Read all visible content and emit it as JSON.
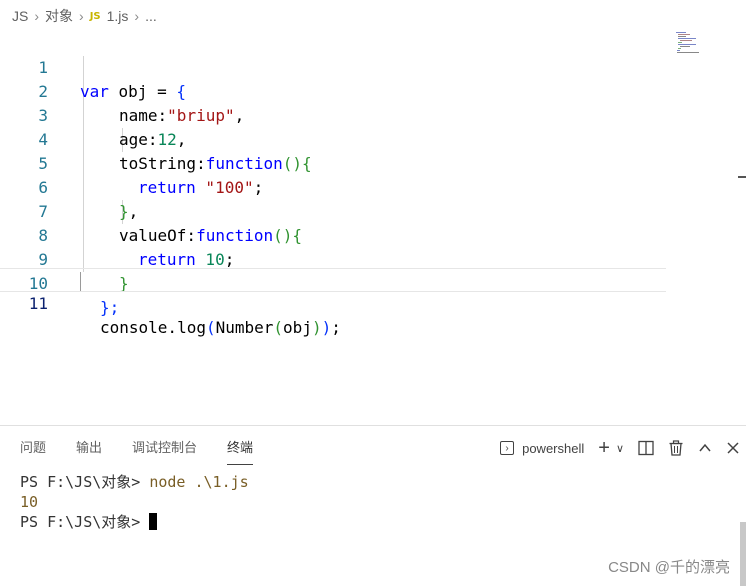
{
  "breadcrumb": {
    "folder1": "JS",
    "folder2": "对象",
    "file_badge": "JS",
    "file": "1.js",
    "more": "..."
  },
  "editor": {
    "lines": [
      {
        "num": "1"
      },
      {
        "num": "2"
      },
      {
        "num": "3"
      },
      {
        "num": "4"
      },
      {
        "num": "5"
      },
      {
        "num": "6"
      },
      {
        "num": "7"
      },
      {
        "num": "8"
      },
      {
        "num": "9"
      },
      {
        "num": "10"
      },
      {
        "num": "11"
      }
    ],
    "tokens": {
      "var": "var",
      "obj_decl": " obj = ",
      "open_brace": "{",
      "name_key": "name:",
      "name_val": "\"briup\"",
      "comma": ",",
      "age_key": "age:",
      "age_val": "12",
      "tostring_key": "toString:",
      "function": "function",
      "paren_open": "(",
      "paren_close": ")",
      "return": "return",
      "tostring_val": " \"100\"",
      "semicolon": ";",
      "close_brace": "}",
      "valueof_key": "valueOf:",
      "valueof_val": " 10",
      "obj_close": "};",
      "console_log": "console.log",
      "number_fn": "Number",
      "obj_arg": "obj"
    }
  },
  "panel": {
    "tabs": [
      "问题",
      "输出",
      "调试控制台",
      "终端"
    ],
    "active_tab": "终端",
    "shell_name": "powershell",
    "terminal": {
      "prompt1": "PS F:\\JS\\对象>",
      "command": " node .\\1.js",
      "output": "10",
      "prompt2": "PS F:\\JS\\对象>"
    }
  },
  "watermark": "CSDN @千的漂亮"
}
